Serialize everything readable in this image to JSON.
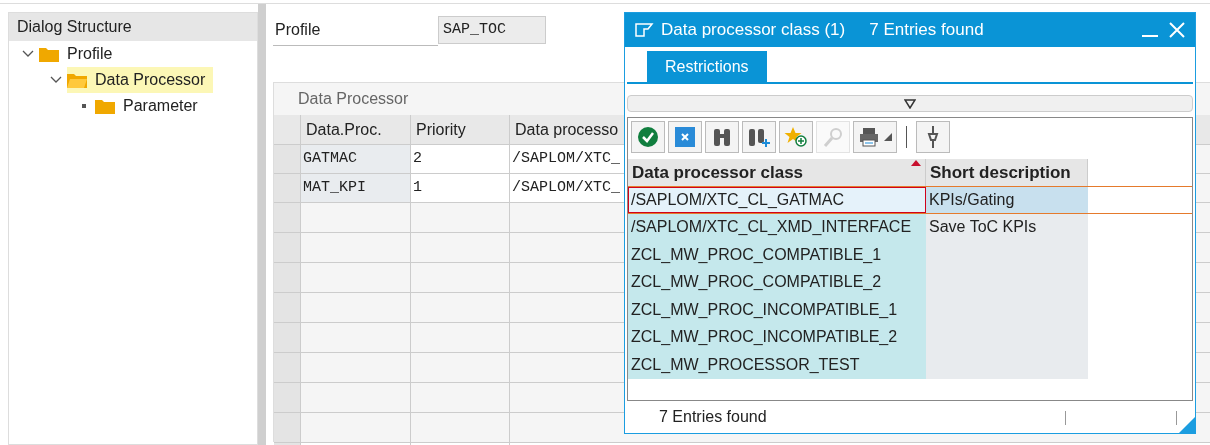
{
  "dialog_structure": {
    "title": "Dialog Structure",
    "tree": [
      {
        "label": "Profile",
        "expanded": true,
        "selected": false,
        "children": [
          {
            "label": "Data Processor",
            "expanded": true,
            "selected": true,
            "children": [
              {
                "label": "Parameter",
                "selected": false
              }
            ]
          }
        ]
      }
    ]
  },
  "profile": {
    "label": "Profile",
    "value": "SAP_TOC"
  },
  "data_processor": {
    "title": "Data Processor",
    "columns": [
      "Data.Proc.",
      "Priority",
      "Data processo"
    ],
    "rows": [
      [
        "GATMAC",
        "2",
        "/SAPLOM/XTC_"
      ],
      [
        "MAT_KPI",
        "1",
        "/SAPLOM/XTC_"
      ]
    ]
  },
  "popup": {
    "title": "Data processor class (1)",
    "subtitle": "7 Entries found",
    "tabs": [
      {
        "label": "Restrictions",
        "selected": true
      }
    ],
    "columns": [
      {
        "label": "Data processor class",
        "sorted": true
      },
      {
        "label": "Short description",
        "sorted": false
      }
    ],
    "rows": [
      {
        "cells": [
          "/SAPLOM/XTC_CL_GATMAC",
          "KPIs/Gating"
        ],
        "selected": true
      },
      {
        "cells": [
          "/SAPLOM/XTC_CL_XMD_INTERFACE",
          "Save ToC KPIs"
        ],
        "selected": false
      },
      {
        "cells": [
          "ZCL_MW_PROC_COMPATIBLE_1"
        ],
        "selected": false
      },
      {
        "cells": [
          "ZCL_MW_PROC_COMPATIBLE_2"
        ],
        "selected": false
      },
      {
        "cells": [
          "ZCL_MW_PROC_INCOMPATIBLE_1"
        ],
        "selected": false
      },
      {
        "cells": [
          "ZCL_MW_PROC_INCOMPATIBLE_2"
        ],
        "selected": false
      },
      {
        "cells": [
          "ZCL_MW_PROCESSOR_TEST"
        ],
        "selected": false
      }
    ],
    "status": "7 Entries found"
  }
}
